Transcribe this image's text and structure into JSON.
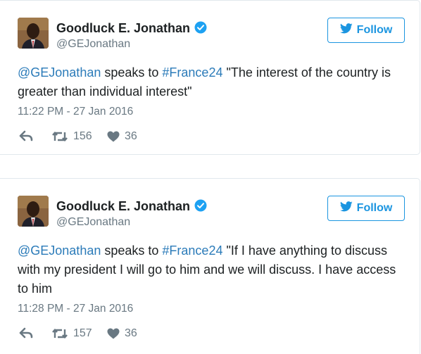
{
  "tweets": [
    {
      "author": {
        "name": "Goodluck E. Jonathan",
        "handle": "@GEJonathan"
      },
      "follow_label": "Follow",
      "text": {
        "mention": "@GEJonathan",
        "middle": " speaks to ",
        "hashtag": "#France24",
        "rest": " \"The interest of the country is greater than individual interest\""
      },
      "timestamp": "11:22 PM - 27 Jan 2016",
      "retweets": "156",
      "likes": "36"
    },
    {
      "author": {
        "name": "Goodluck E. Jonathan",
        "handle": "@GEJonathan"
      },
      "follow_label": "Follow",
      "text": {
        "mention": "@GEJonathan",
        "middle": " speaks to ",
        "hashtag": "#France24",
        "rest": " \"If I have anything to discuss with my president I will go to him and we will discuss. I have access to him"
      },
      "timestamp": "11:28 PM - 27 Jan 2016",
      "retweets": "157",
      "likes": "36"
    }
  ],
  "colors": {
    "accent": "#1b95e0",
    "link": "#2b7bb9",
    "muted": "#697882",
    "verified": "#1da1f2"
  },
  "icons": [
    "verified-badge-icon",
    "twitter-bird-icon",
    "reply-icon",
    "retweet-icon",
    "heart-icon"
  ]
}
